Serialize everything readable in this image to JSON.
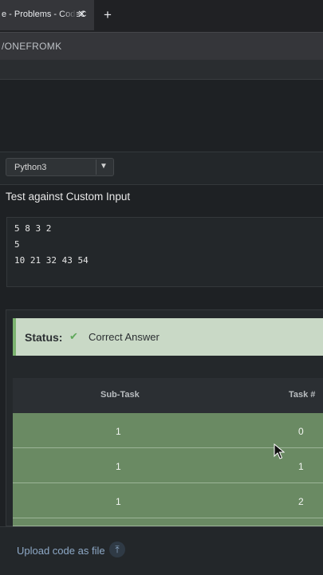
{
  "browser": {
    "tab_title": "e - Problems - CodeC",
    "tab_close": "✕",
    "new_tab": "+",
    "url": "/ONEFROMK"
  },
  "editor": {
    "language": "Python3",
    "custom_input_label": "Test against Custom Input",
    "custom_input_lines": [
      "5 8 3 2",
      "5",
      "10 21 32 43 54"
    ]
  },
  "result": {
    "status_label": "Status:",
    "status_value": "Correct Answer",
    "status_color": "#7bb36f",
    "table": {
      "headers": [
        "Sub-Task",
        "Task #"
      ],
      "rows": [
        {
          "subtask": "1",
          "task": "0"
        },
        {
          "subtask": "1",
          "task": "1"
        },
        {
          "subtask": "1",
          "task": "2"
        }
      ]
    }
  },
  "footer": {
    "upload_label": "Upload code as file",
    "upload_icon": "upload-arrow-icon"
  }
}
